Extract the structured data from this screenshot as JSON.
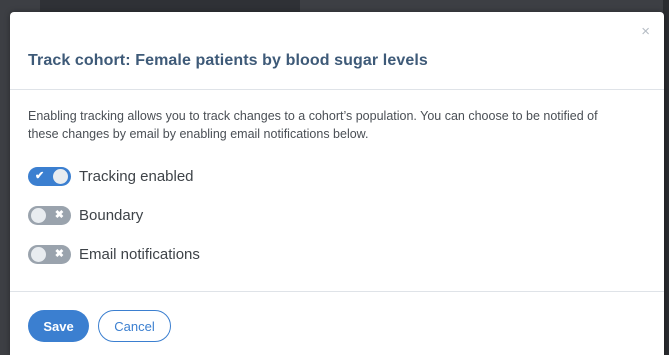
{
  "modal": {
    "title": "Track cohort: Female patients by blood sugar levels",
    "close_glyph": "×",
    "description": "Enabling tracking allows you to track changes to a cohort’s population. You can choose to be notified of these changes by email by enabling email notifications below.",
    "toggles": [
      {
        "label": "Tracking enabled",
        "state": "on",
        "icon": "check-icon",
        "glyph": "✔"
      },
      {
        "label": "Boundary",
        "state": "off",
        "icon": "x-icon",
        "glyph": "✖"
      },
      {
        "label": "Email notifications",
        "state": "off",
        "icon": "x-icon",
        "glyph": "✖"
      }
    ],
    "save_label": "Save",
    "cancel_label": "Cancel"
  },
  "colors": {
    "accent": "#3b7fd0",
    "title": "#3e5a78",
    "toggle_off": "#9aa3ad"
  }
}
